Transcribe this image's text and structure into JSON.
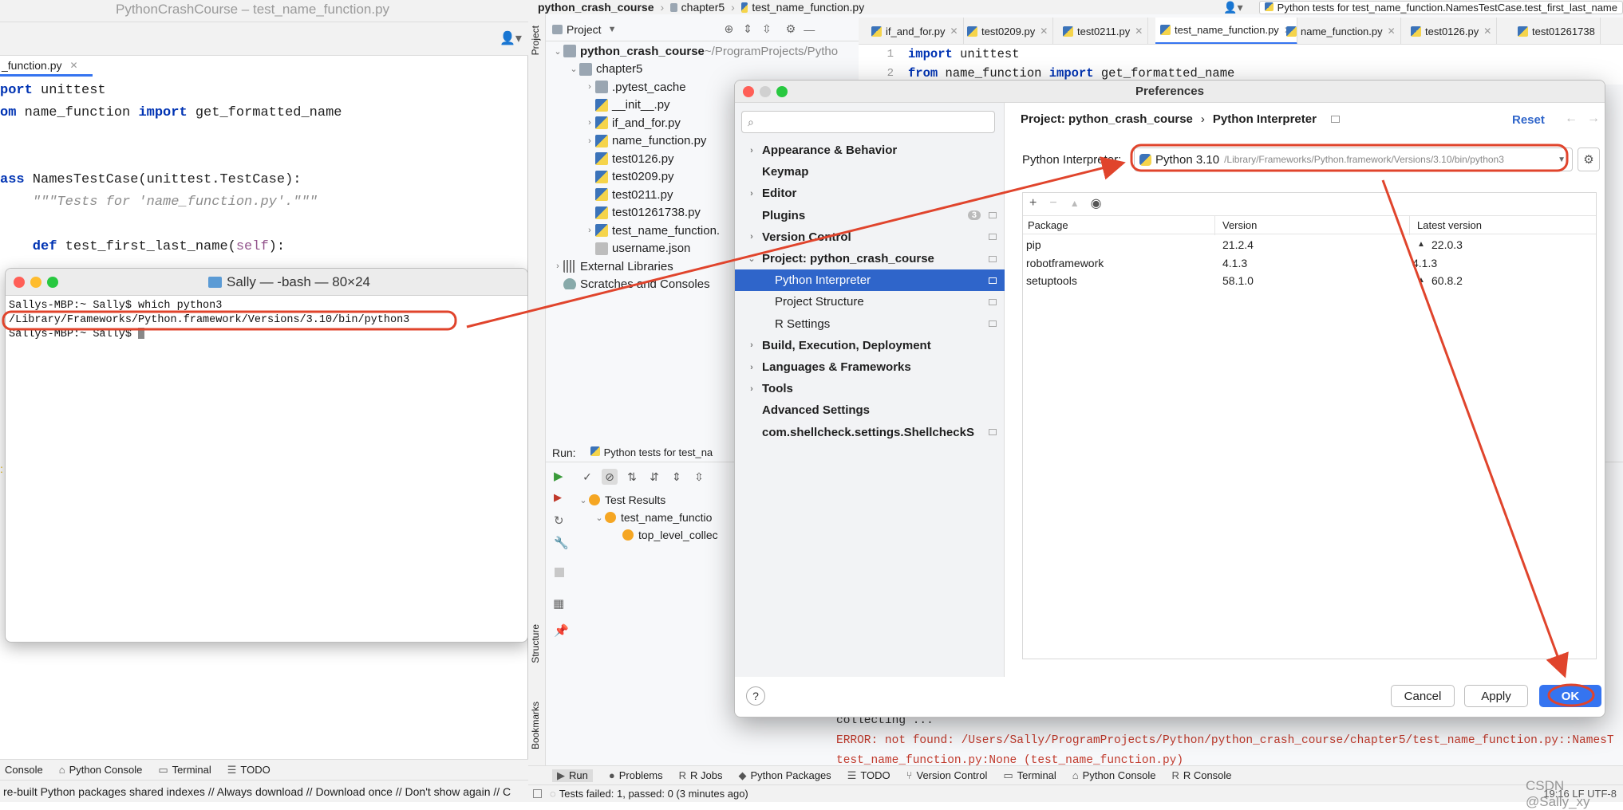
{
  "left_window": {
    "title": "PythonCrashCourse – test_name_function.py",
    "tab_label": "_function.py",
    "code_lines": [
      {
        "k1": "port",
        "t1": " unittest"
      },
      {
        "k1": "om",
        "t1": " name_function ",
        "k2": "import",
        "t2": " get_formatted_name"
      },
      {
        "k1": "",
        "t1": ""
      },
      {
        "k1": "",
        "t1": ""
      },
      {
        "k1": "ass",
        "t1": " NamesTestCase(unittest.TestCase):"
      },
      {
        "cm": "    \"\"\"Tests for 'name_function.py'.\"\"\""
      },
      {
        "k1": "",
        "t1": ""
      },
      {
        "k1": "    def",
        "t1": " test_first_last_name(",
        "sf": "self",
        "t2": "):"
      }
    ],
    "bottom_tabs": [
      "Console",
      "Python Console",
      "Terminal",
      "TODO"
    ],
    "status": "re-built Python packages shared indexes // Always download // Download once // Don't show again // C"
  },
  "terminal": {
    "title": "Sally — -bash — 80×24",
    "line1": "Sallys-MBP:~ Sally$ which python3",
    "line2": "/Library/Frameworks/Python.framework/Versions/3.10/bin/python3",
    "line3": "Sallys-MBP:~ Sally$ "
  },
  "ide": {
    "breadcrumb": [
      "python_crash_course",
      "chapter5",
      "test_name_function.py"
    ],
    "run_config": "Python tests for test_name_function.NamesTestCase.test_first_last_name",
    "project_label": "Project",
    "side_tabs": [
      "Project",
      "Structure",
      "Bookmarks"
    ],
    "editor_tabs": [
      "if_and_for.py",
      "test0209.py",
      "test0211.py",
      "test_name_function.py",
      "name_function.py",
      "test0126.py",
      "test01261738"
    ],
    "tree": [
      {
        "indent": 0,
        "chev": "⌄",
        "icon": "folder",
        "label": "python_crash_course",
        "note": " ~/ProgramProjects/Pytho",
        "bold": true
      },
      {
        "indent": 1,
        "chev": "⌄",
        "icon": "folder",
        "label": "chapter5"
      },
      {
        "indent": 2,
        "chev": "›",
        "icon": "folder",
        "label": ".pytest_cache"
      },
      {
        "indent": 2,
        "chev": "",
        "icon": "py",
        "label": "__init__.py"
      },
      {
        "indent": 2,
        "chev": "›",
        "icon": "py",
        "label": "if_and_for.py"
      },
      {
        "indent": 2,
        "chev": "›",
        "icon": "py",
        "label": "name_function.py"
      },
      {
        "indent": 2,
        "chev": "",
        "icon": "py",
        "label": "test0126.py"
      },
      {
        "indent": 2,
        "chev": "",
        "icon": "py",
        "label": "test0209.py"
      },
      {
        "indent": 2,
        "chev": "",
        "icon": "py",
        "label": "test0211.py"
      },
      {
        "indent": 2,
        "chev": "",
        "icon": "py",
        "label": "test01261738.py"
      },
      {
        "indent": 2,
        "chev": "›",
        "icon": "py",
        "label": "test_name_function."
      },
      {
        "indent": 2,
        "chev": "",
        "icon": "json",
        "label": "username.json"
      },
      {
        "indent": 0,
        "chev": "›",
        "icon": "lib",
        "label": "External Libraries"
      },
      {
        "indent": 0,
        "chev": "",
        "icon": "scratch",
        "label": "Scratches and Consoles"
      }
    ],
    "editor_lines": [
      {
        "n": "1",
        "k": "import",
        "t": " unittest"
      },
      {
        "n": "2",
        "k": "from",
        "t": " name_function ",
        "k2": "import",
        "t2": " get_formatted_name"
      }
    ],
    "run_label": "Run:",
    "run_tab": "Python tests for test_na",
    "test_tree": [
      "Test Results",
      "test_name_functio",
      "top_level_collec"
    ],
    "console": [
      "collecting ...",
      "ERROR: not found: /Users/Sally/ProgramProjects/Python/python_crash_course/chapter5/test_name_function.py::NamesT",
      "test_name_function.py:None (test_name_function.py)"
    ],
    "bottom_tabs": [
      "Run",
      "Problems",
      "R Jobs",
      "Python Packages",
      "TODO",
      "Version Control",
      "Terminal",
      "Python Console",
      "R Console"
    ],
    "status": "Tests failed: 1, passed: 0 (3 minutes ago)",
    "status_right": "19:16   LF   UTF-8",
    "watermark": "CSDN @Sally_xy"
  },
  "prefs": {
    "title": "Preferences",
    "search_placeholder": "",
    "nav": [
      {
        "label": "Appearance & Behavior",
        "chev": "›",
        "bold": true,
        "indent": 0
      },
      {
        "label": "Keymap",
        "chev": "",
        "bold": true,
        "indent": 0
      },
      {
        "label": "Editor",
        "chev": "›",
        "bold": true,
        "indent": 0
      },
      {
        "label": "Plugins",
        "chev": "",
        "bold": true,
        "indent": 0,
        "badge": "3"
      },
      {
        "label": "Version Control",
        "chev": "›",
        "bold": true,
        "indent": 0
      },
      {
        "label": "Project: python_crash_course",
        "chev": "⌄",
        "bold": true,
        "indent": 0
      },
      {
        "label": "Python Interpreter",
        "chev": "",
        "bold": false,
        "indent": 1,
        "selected": true
      },
      {
        "label": "Project Structure",
        "chev": "",
        "bold": false,
        "indent": 1
      },
      {
        "label": "R Settings",
        "chev": "",
        "bold": false,
        "indent": 1
      },
      {
        "label": "Build, Execution, Deployment",
        "chev": "›",
        "bold": true,
        "indent": 0
      },
      {
        "label": "Languages & Frameworks",
        "chev": "›",
        "bold": true,
        "indent": 0
      },
      {
        "label": "Tools",
        "chev": "›",
        "bold": true,
        "indent": 0
      },
      {
        "label": "Advanced Settings",
        "chev": "",
        "bold": true,
        "indent": 0
      },
      {
        "label": "com.shellcheck.settings.ShellcheckS",
        "chev": "",
        "bold": true,
        "indent": 0
      }
    ],
    "breadcrumb_project": "Project: python_crash_course",
    "breadcrumb_sep": "›",
    "breadcrumb_page": "Python Interpreter",
    "reset": "Reset",
    "interp_label": "Python Interpreter:",
    "interp_name": "Python 3.10",
    "interp_path": "/Library/Frameworks/Python.framework/Versions/3.10/bin/python3",
    "table_headers": [
      "Package",
      "Version",
      "Latest version"
    ],
    "packages": [
      {
        "name": "pip",
        "version": "21.2.4",
        "latest": "22.0.3",
        "up": true
      },
      {
        "name": "robotframework",
        "version": "4.1.3",
        "latest": "4.1.3",
        "up": false
      },
      {
        "name": "setuptools",
        "version": "58.1.0",
        "latest": "60.8.2",
        "up": true
      }
    ],
    "help": "?",
    "cancel": "Cancel",
    "apply": "Apply",
    "ok": "OK"
  },
  "colors": {
    "annotation": "#e0442c",
    "selection": "#2f65ca",
    "ok_button": "#3574f0"
  }
}
